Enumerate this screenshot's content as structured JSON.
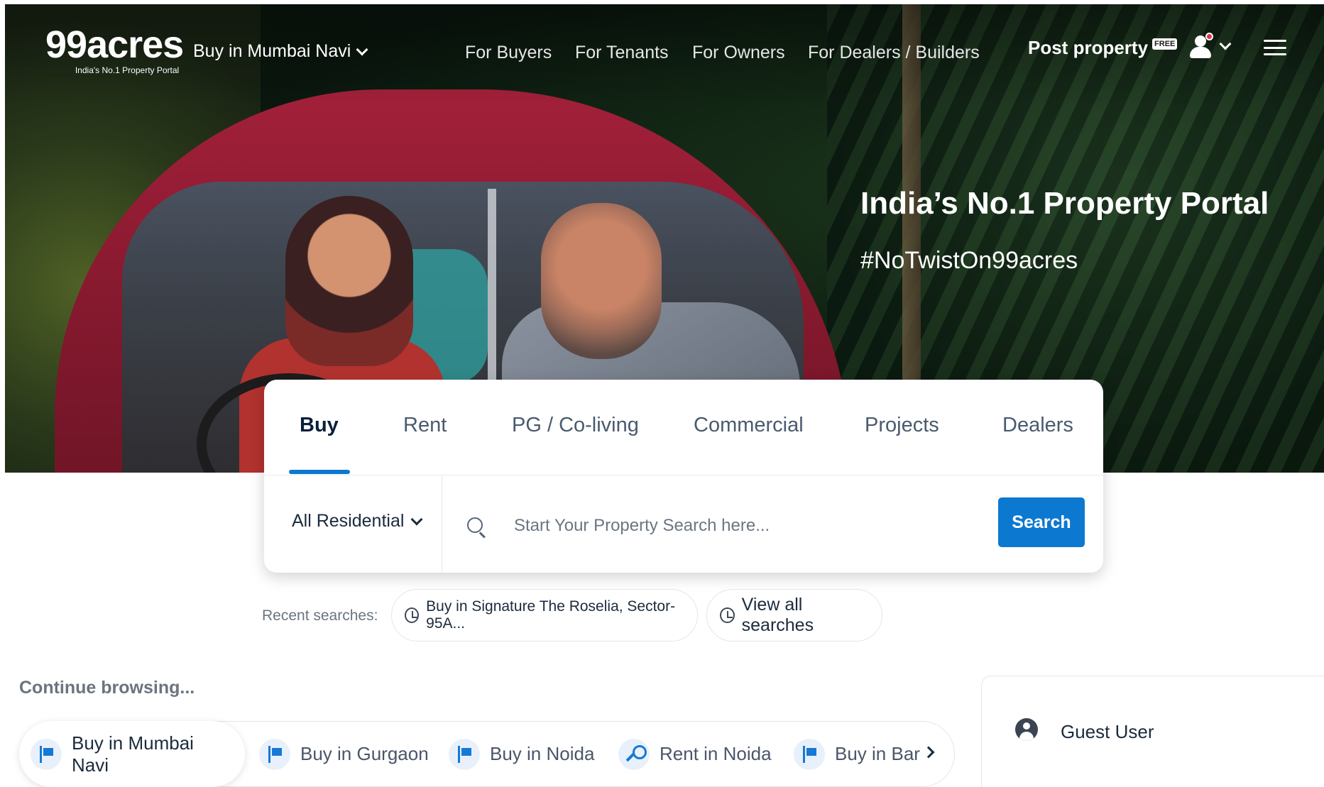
{
  "header": {
    "logo": {
      "brand": "99acres",
      "tagline": "India's No.1 Property Portal"
    },
    "city_select": "Buy in Mumbai Navi",
    "nav": [
      "For Buyers",
      "For Tenants",
      "For Owners",
      "For Dealers / Builders"
    ],
    "post_property": {
      "label": "Post property",
      "badge": "FREE"
    }
  },
  "hero": {
    "title": "India’s No.1 Property Portal",
    "hashtag": "#NoTwistOn99acres"
  },
  "search": {
    "tabs": [
      "Buy",
      "Rent",
      "PG / Co-living",
      "Commercial",
      "Projects",
      "Dealers"
    ],
    "active_tab": "Buy",
    "property_type": "All Residential",
    "placeholder": "Start Your Property Search here...",
    "button_label": "Search"
  },
  "recent": {
    "label": "Recent searches:",
    "items": [
      "Buy in Signature The Roselia, Sector-95A..."
    ],
    "view_all": "View all searches"
  },
  "continue_browsing": {
    "label": "Continue browsing...",
    "items": [
      {
        "label": "Buy in Mumbai Navi",
        "icon": "flag-icon"
      },
      {
        "label": "Buy in Gurgaon",
        "icon": "flag-icon"
      },
      {
        "label": "Buy in Noida",
        "icon": "flag-icon"
      },
      {
        "label": "Rent in Noida",
        "icon": "key-icon"
      },
      {
        "label": "Buy in Bar",
        "icon": "flag-icon"
      }
    ]
  },
  "user_panel": {
    "name": "Guest User"
  },
  "colors": {
    "accent": "#0d78d0",
    "notification": "#e0344a"
  }
}
